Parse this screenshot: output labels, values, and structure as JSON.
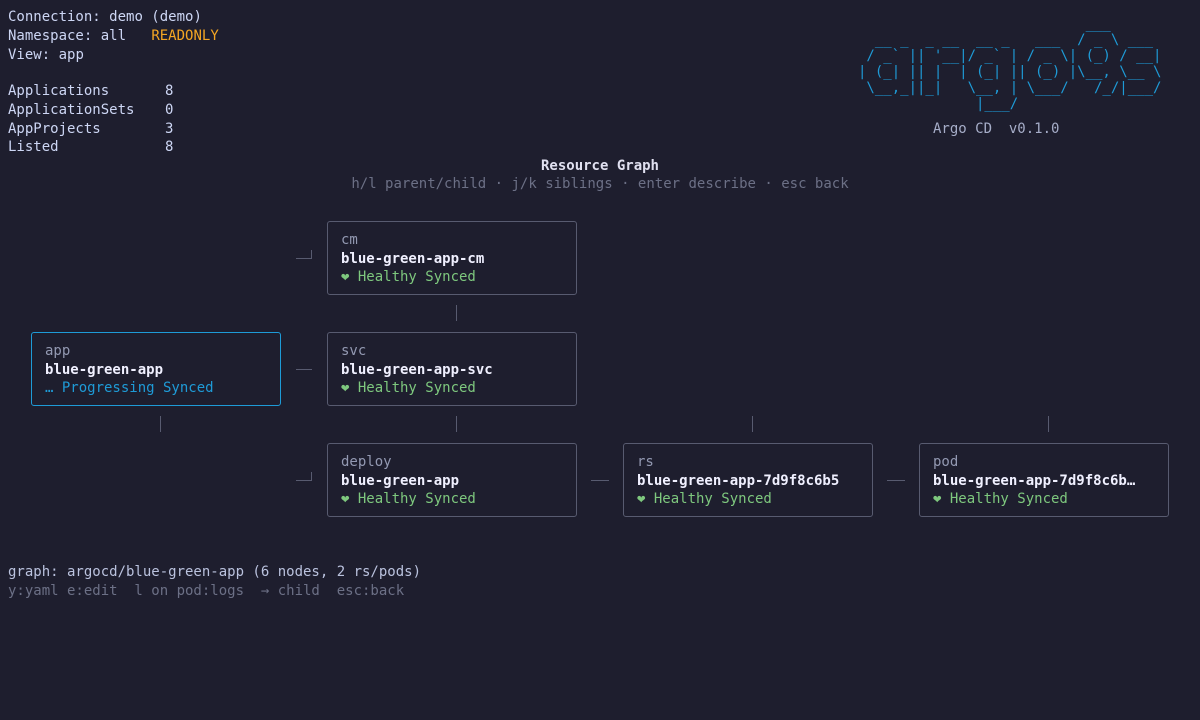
{
  "header": {
    "connection_label": "Connection:",
    "connection_value": "demo (demo)",
    "namespace_label": "Namespace:",
    "namespace_value": "all",
    "readonly_badge": "READONLY",
    "view_label": "View:",
    "view_value": "app"
  },
  "stats": [
    {
      "label": "Applications",
      "value": "8"
    },
    {
      "label": "ApplicationSets",
      "value": "0"
    },
    {
      "label": "AppProjects",
      "value": "3"
    },
    {
      "label": "Listed",
      "value": "8"
    }
  ],
  "brand": {
    "logo_ascii": "                           ___\n  __ _  _ __  __ _   ___  / _ \\ ___\n / _` || '__|/ _` | / _ \\| (_) / __|\n| (_| || |  | (_| || (_) |\\__, \\__ \\\n \\__,_||_|   \\__, | \\___/   /_/|___/\n              |___/",
    "name": "Argo CD",
    "version": "v0.1.0"
  },
  "graph": {
    "title": "Resource Graph",
    "help": "h/l parent/child · j/k siblings · enter describe · esc back",
    "nodes": {
      "app": {
        "kind": "app",
        "name": "blue-green-app",
        "status": "… Progressing Synced"
      },
      "cm": {
        "kind": "cm",
        "name": "blue-green-app-cm",
        "status": "❤ Healthy Synced"
      },
      "svc": {
        "kind": "svc",
        "name": "blue-green-app-svc",
        "status": "❤ Healthy Synced"
      },
      "deploy": {
        "kind": "deploy",
        "name": "blue-green-app",
        "status": "❤ Healthy Synced"
      },
      "rs": {
        "kind": "rs",
        "name": "blue-green-app-7d9f8c6b5",
        "status": "❤ Healthy Synced"
      },
      "pod": {
        "kind": "pod",
        "name": "blue-green-app-7d9f8c6b…",
        "status": "❤ Healthy Synced"
      }
    }
  },
  "footer": {
    "summary": "graph: argocd/blue-green-app (6 nodes, 2 rs/pods)",
    "keys": "y:yaml e:edit  l on pod:logs  → child  esc:back"
  },
  "colors": {
    "background": "#1e1e2e",
    "accent": "#1e9bd7",
    "readonly": "#f5a623",
    "healthy": "#7ec87e"
  }
}
